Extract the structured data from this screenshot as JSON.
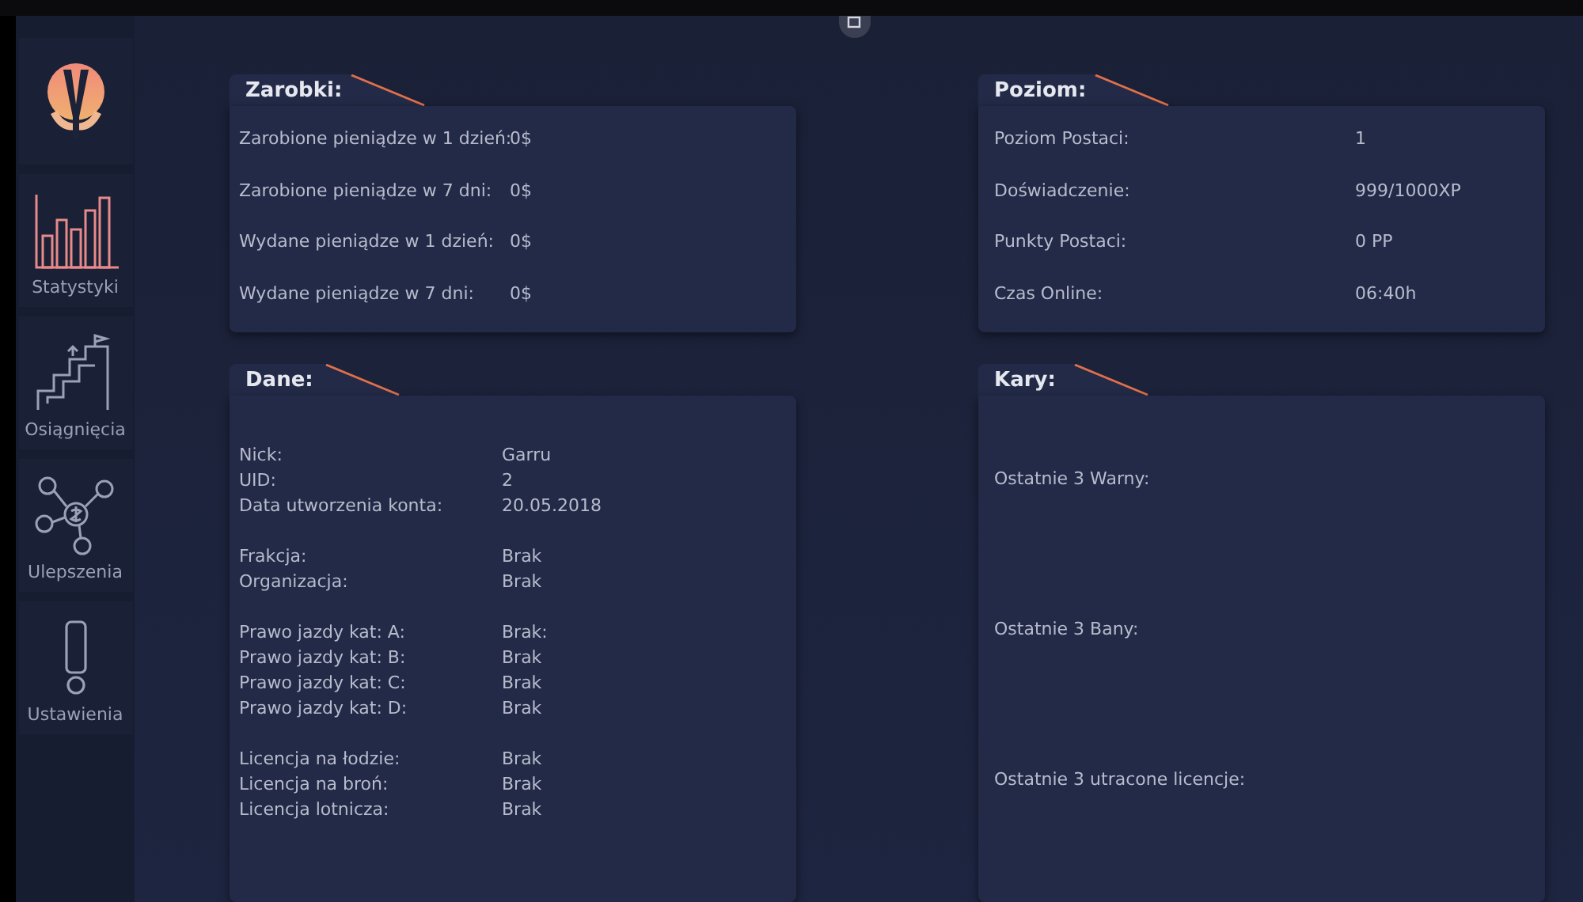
{
  "sidebar": {
    "items": [
      {
        "label": "Statystyki",
        "selected": true
      },
      {
        "label": "Osiągnięcia",
        "selected": false
      },
      {
        "label": "Ulepszenia",
        "selected": false
      },
      {
        "label": "Ustawienia",
        "selected": false
      }
    ]
  },
  "earnings": {
    "title": "Zarobki:",
    "rows": [
      {
        "label": "Zarobione pieniądze w 1 dzień:",
        "value": "0$"
      },
      {
        "label": "Zarobione pieniądze w 7 dni:",
        "value": "0$"
      },
      {
        "label": "Wydane pieniądze w 1 dzień:",
        "value": "0$"
      },
      {
        "label": "Wydane pieniądze w 7 dni:",
        "value": "0$"
      }
    ]
  },
  "level": {
    "title": "Poziom:",
    "rows": [
      {
        "label": "Poziom Postaci:",
        "value": "1"
      },
      {
        "label": "Doświadczenie:",
        "value": "999/1000XP"
      },
      {
        "label": "Punkty Postaci:",
        "value": "0 PP"
      },
      {
        "label": "Czas Online:",
        "value": "06:40h"
      }
    ]
  },
  "data": {
    "title": "Dane:",
    "groups": [
      [
        {
          "label": "Nick:",
          "value": "Garru"
        },
        {
          "label": "UID:",
          "value": "2"
        },
        {
          "label": "Data utworzenia konta:",
          "value": "20.05.2018"
        }
      ],
      [
        {
          "label": "Frakcja:",
          "value": "Brak"
        },
        {
          "label": "Organizacja:",
          "value": "Brak"
        }
      ],
      [
        {
          "label": "Prawo jazdy kat: A:",
          "value": "Brak:"
        },
        {
          "label": "Prawo jazdy kat: B:",
          "value": "Brak"
        },
        {
          "label": "Prawo jazdy kat: C:",
          "value": "Brak"
        },
        {
          "label": "Prawo jazdy kat: D:",
          "value": "Brak"
        }
      ],
      [
        {
          "label": "Licencja na łodzie:",
          "value": "Brak"
        },
        {
          "label": "Licencja na broń:",
          "value": "Brak"
        },
        {
          "label": "Licencja lotnicza:",
          "value": "Brak"
        }
      ]
    ]
  },
  "penalties": {
    "title": "Kary:",
    "items": [
      "Ostatnie 3 Warny:",
      "Ostatnie 3 Bany:",
      "Ostatnie 3 utracone licencje:"
    ]
  }
}
